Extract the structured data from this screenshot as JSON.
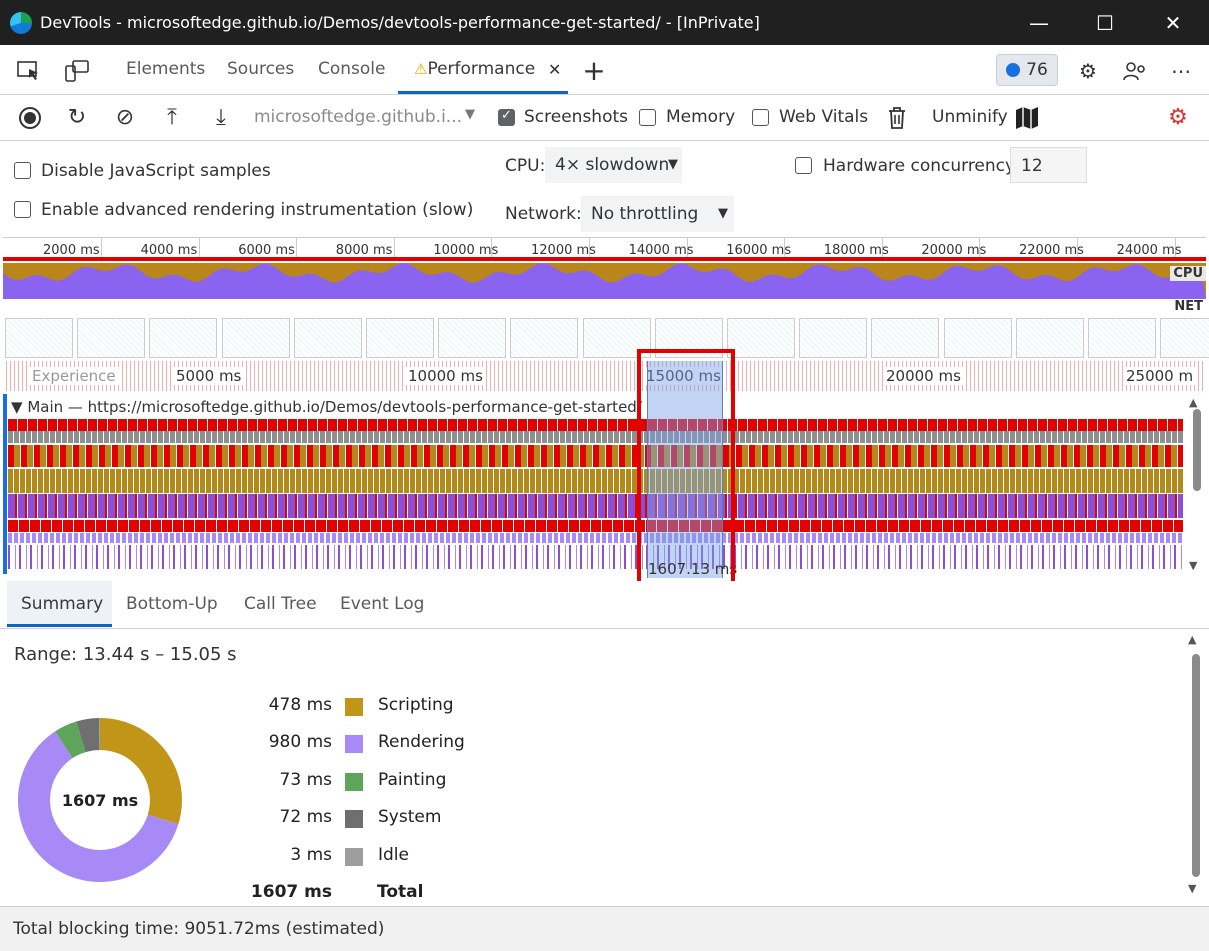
{
  "window": {
    "title": "DevTools - microsoftedge.github.io/Demos/devtools-performance-get-started/ - [InPrivate]",
    "minimize": "—",
    "maximize": "☐",
    "close": "✕"
  },
  "tabs": [
    {
      "label": "Elements"
    },
    {
      "label": "Sources"
    },
    {
      "label": "Console"
    },
    {
      "label": "Performance"
    }
  ],
  "issues_count": "76",
  "toolbar": {
    "url_select": "microsoftedge.github.i...",
    "screenshots_label": "Screenshots",
    "memory_label": "Memory",
    "web_vitals_label": "Web Vitals",
    "unminify_label": "Unminify"
  },
  "settings": {
    "disable_js_label": "Disable JavaScript samples",
    "advanced_render_label": "Enable advanced rendering instrumentation (slow)",
    "cpu_label": "CPU:",
    "cpu_value": "4× slowdown",
    "hardware_label": "Hardware concurrency",
    "hardware_value": "12",
    "network_label": "Network:",
    "network_value": "No throttling"
  },
  "overview": {
    "ticks": [
      "2000 ms",
      "4000 ms",
      "6000 ms",
      "8000 ms",
      "10000 ms",
      "12000 ms",
      "14000 ms",
      "16000 ms",
      "18000 ms",
      "20000 ms",
      "22000 ms",
      "24000 ms"
    ],
    "cpu_label": "CPU",
    "net_label": "NET"
  },
  "timeline": {
    "experience_label": "Experience",
    "ticks": [
      "5000 ms",
      "10000 ms",
      "15000 ms",
      "20000 ms",
      "25000 m"
    ],
    "main_label": "Main — https://microsoftedge.github.io/Demos/devtools-performance-get-started/",
    "selection_duration": "1607.13 ms"
  },
  "bottom_tabs": [
    {
      "label": "Summary"
    },
    {
      "label": "Bottom-Up"
    },
    {
      "label": "Call Tree"
    },
    {
      "label": "Event Log"
    }
  ],
  "summary": {
    "range": "Range: 13.44 s – 15.05 s",
    "donut_center": "1607 ms",
    "items": [
      {
        "value": "478 ms",
        "name": "Scripting",
        "ms": 478,
        "color": "#c19518"
      },
      {
        "value": "980 ms",
        "name": "Rendering",
        "ms": 980,
        "color": "#a78af5"
      },
      {
        "value": "73 ms",
        "name": "Painting",
        "ms": 73,
        "color": "#5ea55c"
      },
      {
        "value": "72 ms",
        "name": "System",
        "ms": 72,
        "color": "#6f6f6f"
      },
      {
        "value": "3 ms",
        "name": "Idle",
        "ms": 3,
        "color": "#9e9e9e"
      }
    ],
    "total_value": "1607 ms",
    "total_label": "Total"
  },
  "status": {
    "text": "Total blocking time: 9051.72ms (estimated)"
  },
  "colors": {
    "accent": "#0c67c0",
    "highlight": "#e30000",
    "scripting": "#c19518",
    "rendering": "#8a63f0",
    "painting": "#5ea55c"
  }
}
